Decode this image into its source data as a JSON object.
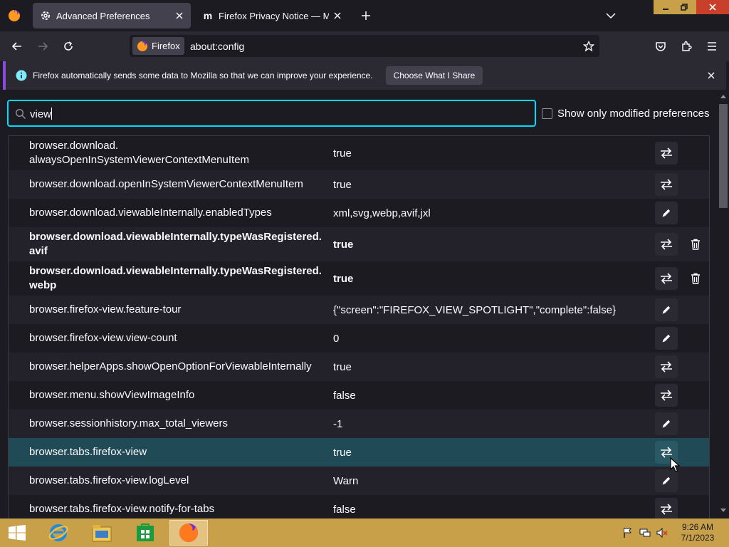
{
  "tabs": [
    {
      "title": "Advanced Preferences",
      "icon": "gear-icon",
      "active": true
    },
    {
      "title": "Firefox Privacy Notice — Mozill",
      "icon": "mozilla-m-icon",
      "active": false
    }
  ],
  "toolbar": {
    "identity_label": "Firefox",
    "url": "about:config"
  },
  "notification": {
    "text": "Firefox automatically sends some data to Mozilla so that we can improve your experience.",
    "button_label": "Choose What I Share"
  },
  "search": {
    "value": "view"
  },
  "modified_only_label": "Show only modified preferences",
  "preferences": [
    {
      "name": "browser.download.\nalwaysOpenInSystemViewerContextMenuItem",
      "value": "true",
      "action": "toggle",
      "modified": false,
      "row_h": 48
    },
    {
      "name": "browser.download.openInSystemViewerContextMenuItem",
      "value": "true",
      "action": "toggle",
      "modified": false,
      "row_h": 40
    },
    {
      "name": "browser.download.viewableInternally.enabledTypes",
      "value": "xml,svg,webp,avif,jxl",
      "action": "edit",
      "modified": false,
      "row_h": 40
    },
    {
      "name": "browser.download.viewableInternally.typeWasRegistered.\navif",
      "value": "true",
      "action": "toggle",
      "modified": true,
      "row_h": 48
    },
    {
      "name": "browser.download.viewableInternally.typeWasRegistered.\nwebp",
      "value": "true",
      "action": "toggle",
      "modified": true,
      "row_h": 48
    },
    {
      "name": "browser.firefox-view.feature-tour",
      "value": "{\"screen\":\"FIREFOX_VIEW_SPOTLIGHT\",\"complete\":false}",
      "action": "edit",
      "modified": false,
      "row_h": 40
    },
    {
      "name": "browser.firefox-view.view-count",
      "value": "0",
      "action": "edit",
      "modified": false,
      "row_h": 40
    },
    {
      "name": "browser.helperApps.showOpenOptionForViewableInternally",
      "value": "true",
      "action": "toggle",
      "modified": false,
      "row_h": 40
    },
    {
      "name": "browser.menu.showViewImageInfo",
      "value": "false",
      "action": "toggle",
      "modified": false,
      "row_h": 40
    },
    {
      "name": "browser.sessionhistory.max_total_viewers",
      "value": "-1",
      "action": "edit",
      "modified": false,
      "row_h": 40
    },
    {
      "name": "browser.tabs.firefox-view",
      "value": "true",
      "action": "toggle",
      "modified": false,
      "row_h": 40,
      "hover": true
    },
    {
      "name": "browser.tabs.firefox-view.logLevel",
      "value": "Warn",
      "action": "edit",
      "modified": false,
      "row_h": 40
    },
    {
      "name": "browser.tabs.firefox-view.notify-for-tabs",
      "value": "false",
      "action": "toggle",
      "modified": false,
      "row_h": 40
    }
  ],
  "taskbar": {
    "apps": [
      "internet-explorer-icon",
      "file-explorer-icon",
      "store-icon",
      "firefox-icon"
    ],
    "time": "9:26 AM",
    "date": "7/1/2023"
  },
  "colors": {
    "accent": "#00ddff",
    "hover_row": "#1f4a56",
    "taskbar": "#c8a04a"
  }
}
